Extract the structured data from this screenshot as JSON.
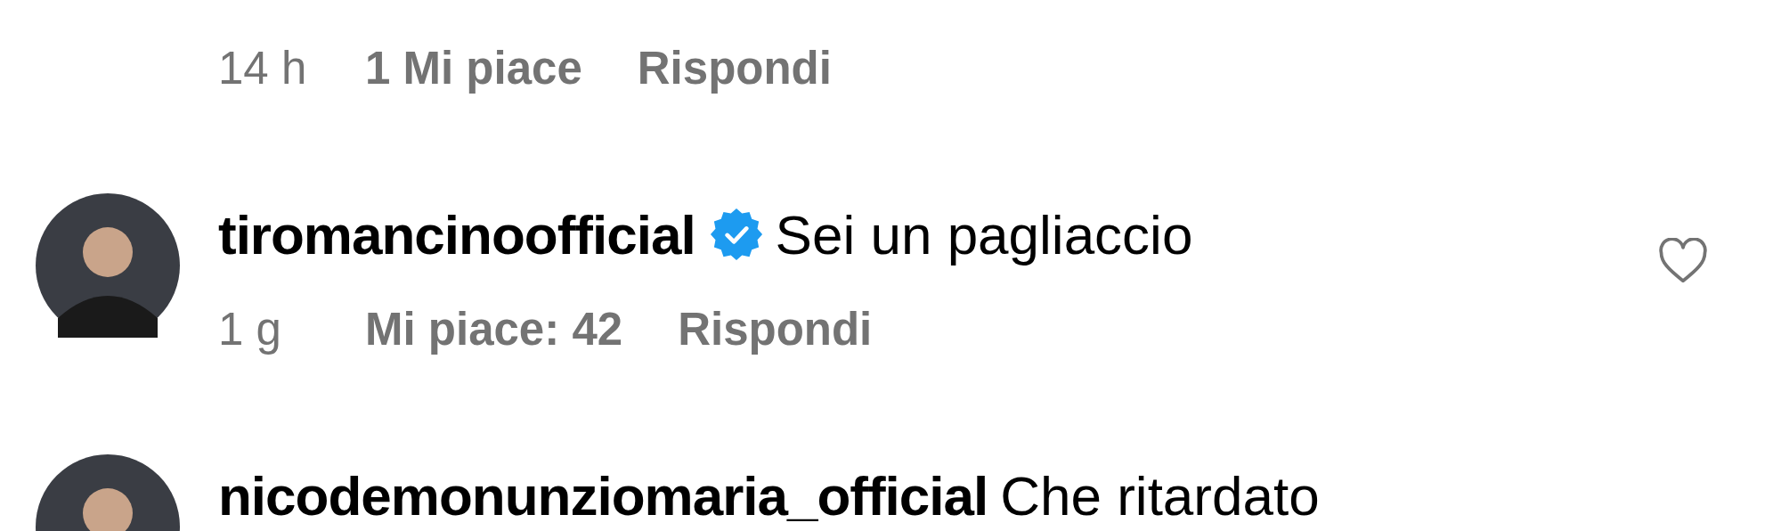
{
  "comments": [
    {
      "time": "14 h",
      "likes": "1 Mi piace",
      "reply": "Rispondi"
    },
    {
      "username": "tiromancinoofficial",
      "verified": true,
      "text": "Sei un pagliaccio",
      "liked": false,
      "time": "1 g",
      "likes": "Mi piace: 42",
      "reply": "Rispondi"
    },
    {
      "username": "nicodemonunziomaria_official",
      "verified": false,
      "text": "Che ritardato"
    }
  ]
}
